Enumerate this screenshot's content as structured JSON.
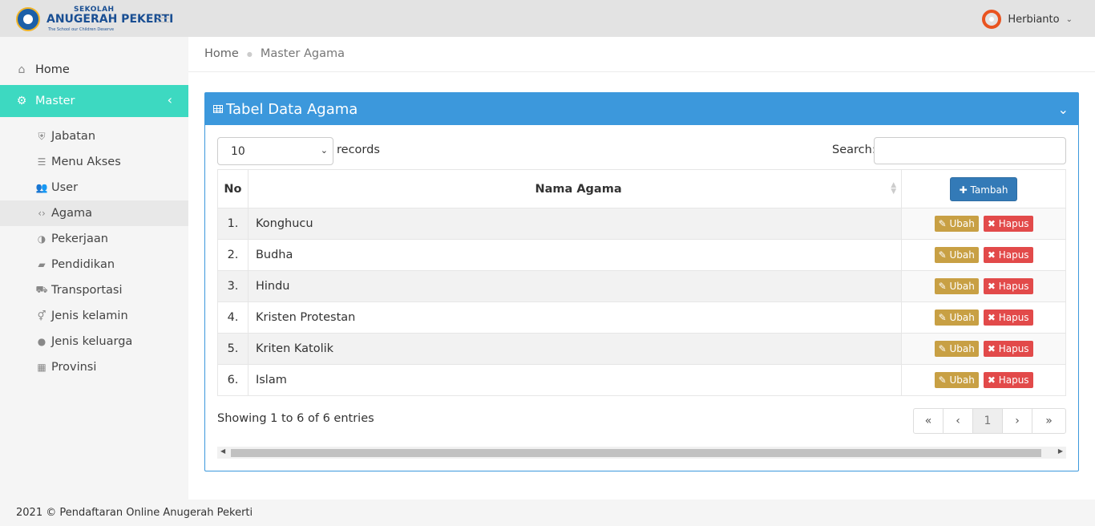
{
  "brand": {
    "line1": "SEKOLAH",
    "line2": "ANUGERAH PEKERTI",
    "tagline": "The School our Children Deserve"
  },
  "header": {
    "user_name": "Herbianto"
  },
  "sidebar": {
    "home_label": "Home",
    "master_label": "Master",
    "items": [
      {
        "label": "Jabatan",
        "icon": "shield-icon"
      },
      {
        "label": "Menu Akses",
        "icon": "list-icon"
      },
      {
        "label": "User",
        "icon": "users-icon"
      },
      {
        "label": "Agama",
        "icon": "code-icon",
        "active": true
      },
      {
        "label": "Pekerjaan",
        "icon": "half-circle-icon"
      },
      {
        "label": "Pendidikan",
        "icon": "book-icon"
      },
      {
        "label": "Transportasi",
        "icon": "car-icon"
      },
      {
        "label": "Jenis kelamin",
        "icon": "gender-icon"
      },
      {
        "label": "Jenis keluarga",
        "icon": "user-icon"
      },
      {
        "label": "Provinsi",
        "icon": "building-icon"
      }
    ]
  },
  "breadcrumb": {
    "home": "Home",
    "current": "Master Agama"
  },
  "panel": {
    "title": "Tabel Data Agama",
    "length_value": "10",
    "length_suffix": "records",
    "search_label": "Search:",
    "search_value": "",
    "columns": {
      "no": "No",
      "name": "Nama Agama",
      "add_button": "Tambah"
    },
    "edit_label": "Ubah",
    "delete_label": "Hapus",
    "rows": [
      {
        "no": "1.",
        "name": "Konghucu"
      },
      {
        "no": "2.",
        "name": "Budha"
      },
      {
        "no": "3.",
        "name": "Hindu"
      },
      {
        "no": "4.",
        "name": "Kristen Protestan"
      },
      {
        "no": "5.",
        "name": "Kriten Katolik"
      },
      {
        "no": "6.",
        "name": "Islam"
      }
    ],
    "info": "Showing 1 to 6 of 6 entries",
    "pagination": {
      "first": "«",
      "prev": "‹",
      "current": "1",
      "next": "›",
      "last": "»"
    }
  },
  "footer": {
    "text": "2021 © Pendaftaran Online Anugerah Pekerti"
  },
  "colors": {
    "accent": "#3dd9c1",
    "panel": "#3c98dc",
    "edit": "#c8a044",
    "delete": "#e24a4a",
    "add": "#337ab7"
  }
}
